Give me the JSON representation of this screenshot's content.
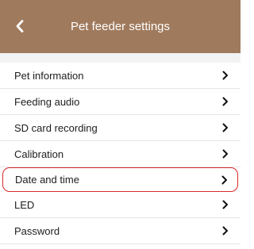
{
  "header": {
    "title": "Pet feeder settings",
    "back_icon": "chevron-left-icon",
    "background_color": "#a07a5d",
    "text_color": "#ffffff"
  },
  "settings": {
    "items": [
      {
        "label": "Pet information",
        "icon": "chevron-right-icon"
      },
      {
        "label": "Feeding audio",
        "icon": "chevron-right-icon"
      },
      {
        "label": "SD card recording",
        "icon": "chevron-right-icon"
      },
      {
        "label": "Calibration",
        "icon": "chevron-right-icon"
      },
      {
        "label": "Date and time",
        "icon": "chevron-right-icon",
        "highlighted": true,
        "highlight_color": "#d72b2b"
      },
      {
        "label": "LED",
        "icon": "chevron-right-icon"
      },
      {
        "label": "Password",
        "icon": "chevron-right-icon"
      }
    ]
  }
}
